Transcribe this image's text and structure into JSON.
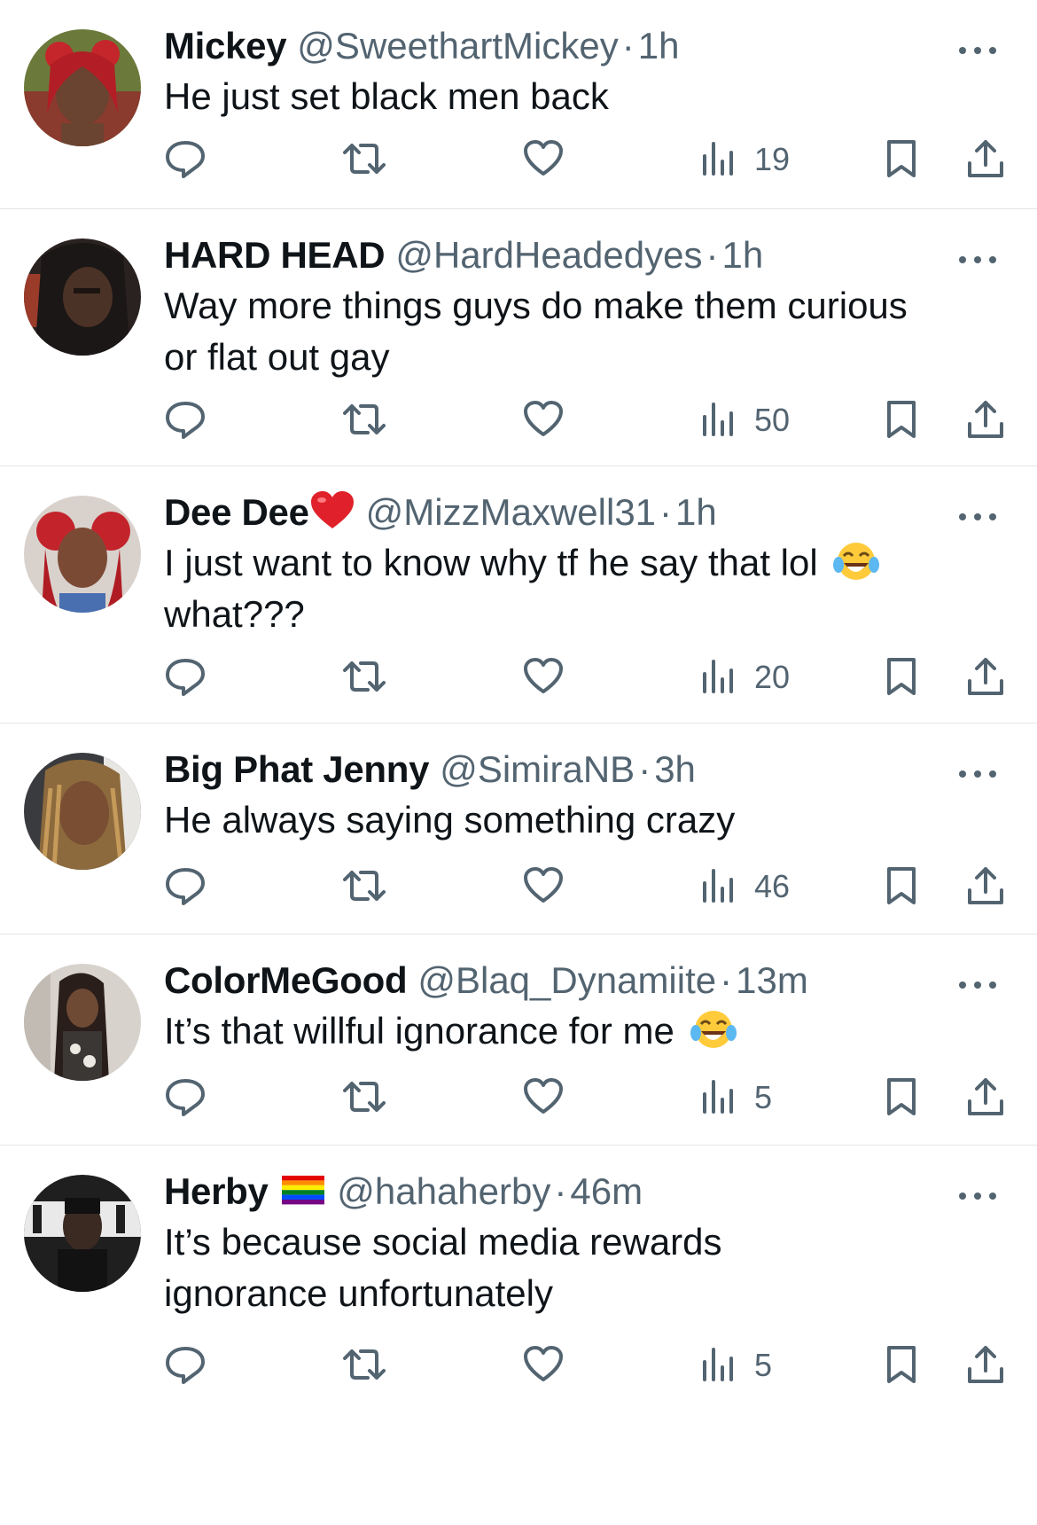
{
  "colors": {
    "text_primary": "#0f1419",
    "text_secondary": "#536471",
    "icon": "#536471",
    "divider": "#e1e5e8"
  },
  "replies": [
    {
      "name": "Mickey",
      "handle": "@SweethartMickey",
      "separator": "·",
      "time": "1h",
      "text": "He just set black men back",
      "views": "19",
      "name_emoji": null,
      "text_emoji": null
    },
    {
      "name": "HARD HEAD",
      "handle": "@HardHeadedyes",
      "separator": "·",
      "time": "1h",
      "text": "Way more things guys do make them curious or flat out gay",
      "views": "50",
      "name_emoji": null,
      "text_emoji": null
    },
    {
      "name": "Dee Dee",
      "handle": "@MizzMaxwell31",
      "separator": "·",
      "time": "1h",
      "text": "I just want to know why tf he say that lol",
      "text_tail": "what???",
      "views": "20",
      "name_emoji": "red-heart-emoji",
      "text_emoji": "tears-of-joy-emoji"
    },
    {
      "name": "Big Phat Jenny",
      "handle": "@SimiraNB",
      "separator": "·",
      "time": "3h",
      "text": "He always saying something crazy",
      "views": "46",
      "name_emoji": null,
      "text_emoji": null
    },
    {
      "name": "ColorMeGood",
      "handle": "@Blaq_Dynamiite",
      "separator": "·",
      "time": "13m",
      "text": "It’s that willful ignorance for me",
      "views": "5",
      "name_emoji": null,
      "text_emoji": "tears-of-joy-emoji"
    },
    {
      "name": "Herby",
      "handle": "@hahaherby",
      "separator": "·",
      "time": "46m",
      "text": "It’s because social media rewards ignorance unfortunately",
      "views": "5",
      "name_emoji": "rainbow-flag-emoji",
      "text_emoji": null
    }
  ]
}
